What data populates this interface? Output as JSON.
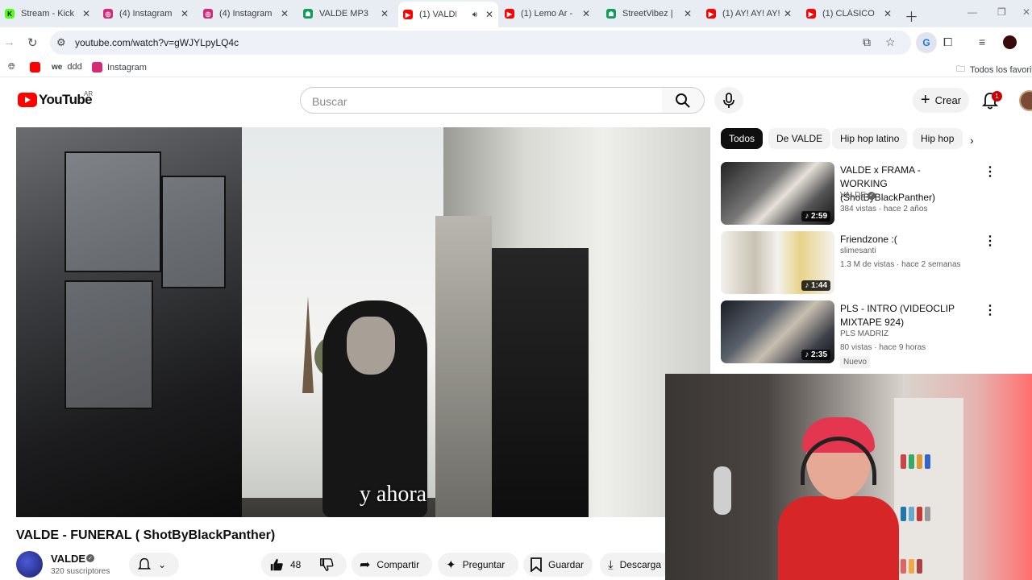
{
  "browser": {
    "tabs": [
      {
        "label": "Stream - Kick",
        "color": "#53fc18",
        "glyph": "K"
      },
      {
        "label": "(4) Instagram",
        "color": "#d62976",
        "glyph": "◎"
      },
      {
        "label": "(4) Instagram",
        "color": "#d62976",
        "glyph": "◎"
      },
      {
        "label": "VALDE MP3",
        "color": "#0f9d58",
        "glyph": "☗"
      },
      {
        "label": "(1) VALDE",
        "color": "#ff0000",
        "glyph": "▶"
      },
      {
        "label": "(1) Lemo Ar -",
        "color": "#ff0000",
        "glyph": "▶"
      },
      {
        "label": "StreetVibez |",
        "color": "#0f9d58",
        "glyph": "☗"
      },
      {
        "label": "(1) AY! AY! AY!",
        "color": "#ff0000",
        "glyph": "▶"
      },
      {
        "label": "(1) CLÁSICO",
        "color": "#ff0000",
        "glyph": "▶"
      }
    ],
    "active_tab_index": 4,
    "url": "youtube.com/watch?v=gWJYLpyLQ4c",
    "bookmarks": [
      {
        "label": "ddd",
        "color": "#000000"
      },
      {
        "label": "Instagram",
        "color": "#d62976"
      }
    ],
    "bookmarks_folder": "Todos los favoritos"
  },
  "youtube": {
    "logo_text": "YouTube",
    "region": "AR",
    "search_placeholder": "Buscar",
    "create_label": "Crear",
    "notification_count": "1",
    "brand_color": "#ff0000"
  },
  "video": {
    "subtitle": "y ahora",
    "title": "VALDE - FUNERAL ( ShotByBlackPanther)",
    "channel": "VALDE",
    "subscribers": "320 suscriptores",
    "likes": "48",
    "share_label": "Compartir",
    "ask_label": "Preguntar",
    "save_label": "Guardar",
    "download_label": "Descarga"
  },
  "sidebar": {
    "chips": [
      "Todos",
      "De VALDE",
      "Hip hop latino",
      "Hip hop"
    ],
    "recommendations": [
      {
        "title": "VALDE x FRAMA - WORKING (ShotByBlackPanther)",
        "channel": "VALDE",
        "verified": true,
        "meta": "384 vistas · hace 2 años",
        "duration": "2:59",
        "badge": ""
      },
      {
        "title": "Friendzone :(",
        "channel": "slimesanti",
        "verified": false,
        "meta": "1.3 M de vistas · hace 2 semanas",
        "duration": "1:44",
        "badge": ""
      },
      {
        "title": "PLS  - INTRO  (VIDEOCLIP MIXTAPE 924)",
        "channel": "PLS MADRIZ",
        "verified": false,
        "meta": "80 vistas · hace 9 horas",
        "duration": "2:35",
        "badge": "Nuevo"
      }
    ]
  }
}
